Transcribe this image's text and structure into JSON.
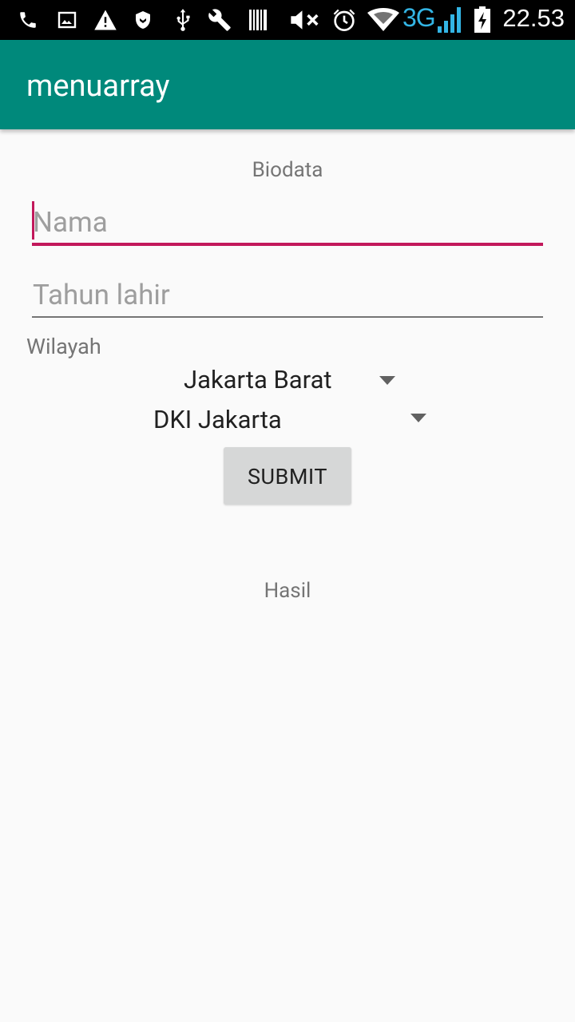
{
  "status_bar": {
    "icons": [
      "phone-icon",
      "image-icon",
      "warning-icon",
      "shield-icon",
      "usb-icon",
      "wrench-icon",
      "barcode-icon",
      "mute-icon",
      "alarm-icon",
      "wifi-icon",
      "network-3g-icon",
      "signal-icon",
      "battery-icon"
    ],
    "network": "3G",
    "time": "22.53",
    "network_color": "#33b5e5"
  },
  "app_bar": {
    "title": "menuarray",
    "color": "#00897b"
  },
  "form": {
    "heading": "Biodata",
    "name_placeholder": "Nama",
    "name_value": "",
    "year_placeholder": "Tahun lahir",
    "year_value": "",
    "region_label": "Wilayah",
    "city_selected": "Jakarta Barat",
    "province_selected": "DKI Jakarta",
    "submit_label": "SUBMIT",
    "accent_color": "#c2185b"
  },
  "result": {
    "label": "Hasil"
  }
}
